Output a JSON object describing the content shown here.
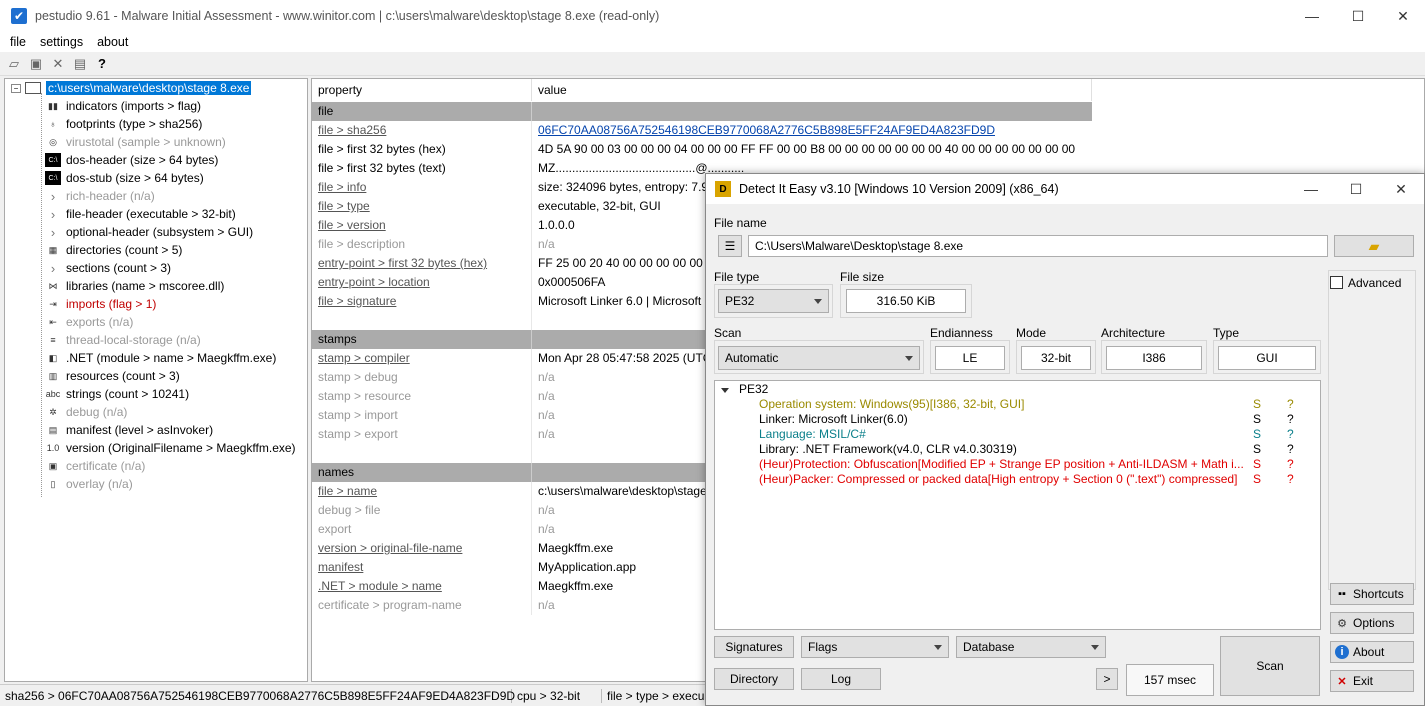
{
  "pestudio": {
    "title": "pestudio 9.61 - Malware Initial Assessment - www.winitor.com | c:\\users\\malware\\desktop\\stage 8.exe (read-only)",
    "menu": [
      "file",
      "settings",
      "about"
    ],
    "tree": {
      "root": "c:\\users\\malware\\desktop\\stage 8.exe",
      "items": [
        {
          "label": "indicators (imports > flag)",
          "icon": "bar-chart-icon",
          "state": "normal"
        },
        {
          "label": "footprints (type > sha256)",
          "icon": "footprints-icon",
          "state": "normal"
        },
        {
          "label": "virustotal (sample > unknown)",
          "icon": "virustotal-icon",
          "state": "dim"
        },
        {
          "label": "dos-header (size > 64 bytes)",
          "icon": "console-icon",
          "state": "normal"
        },
        {
          "label": "dos-stub (size > 64 bytes)",
          "icon": "console-icon",
          "state": "normal"
        },
        {
          "label": "rich-header (n/a)",
          "icon": "chevron-right-icon",
          "state": "dim"
        },
        {
          "label": "file-header (executable > 32-bit)",
          "icon": "chevron-right-icon",
          "state": "normal"
        },
        {
          "label": "optional-header (subsystem > GUI)",
          "icon": "chevron-right-icon",
          "state": "normal"
        },
        {
          "label": "directories (count > 5)",
          "icon": "grid-icon",
          "state": "normal"
        },
        {
          "label": "sections (count > 3)",
          "icon": "chevron-right-icon",
          "state": "normal"
        },
        {
          "label": "libraries (name > mscoree.dll)",
          "icon": "share-icon",
          "state": "normal"
        },
        {
          "label": "imports (flag > 1)",
          "icon": "imports-icon",
          "state": "red"
        },
        {
          "label": "exports (n/a)",
          "icon": "exports-icon",
          "state": "dim"
        },
        {
          "label": "thread-local-storage (n/a)",
          "icon": "thread-icon",
          "state": "dim"
        },
        {
          "label": ".NET (module > name > Maegkffm.exe)",
          "icon": "dotnet-icon",
          "state": "normal"
        },
        {
          "label": "resources (count > 3)",
          "icon": "resources-icon",
          "state": "normal"
        },
        {
          "label": "strings (count > 10241)",
          "icon": "abc-icon",
          "state": "normal"
        },
        {
          "label": "debug (n/a)",
          "icon": "bug-icon",
          "state": "dim"
        },
        {
          "label": "manifest (level > asInvoker)",
          "icon": "manifest-icon",
          "state": "normal"
        },
        {
          "label": "version (OriginalFilename > Maegkffm.exe)",
          "icon": "version-icon",
          "state": "normal"
        },
        {
          "label": "certificate (n/a)",
          "icon": "certificate-icon",
          "state": "dim"
        },
        {
          "label": "overlay (n/a)",
          "icon": "page-icon",
          "state": "dim"
        }
      ]
    },
    "table": {
      "headers": [
        "property",
        "value"
      ],
      "rows": [
        {
          "type": "group",
          "property": "file",
          "value": ""
        },
        {
          "type": "row",
          "property": "file > sha256",
          "value": "06FC70AA08756A752546198CEB9770068A2776C5B898E5FF24AF9ED4A823FD9D",
          "pstyle": "ul",
          "vstyle": "link"
        },
        {
          "type": "row",
          "property": "file > first 32 bytes (hex)",
          "value": "4D 5A 90 00 03 00 00 00 04 00 00 00 FF FF 00 00 B8 00 00 00 00 00 00 00 40 00 00 00 00 00 00 00",
          "pstyle": "",
          "vstyle": ""
        },
        {
          "type": "row",
          "property": "file > first 32 bytes (text)",
          "value": "MZ..........................................@...........",
          "pstyle": "",
          "vstyle": ""
        },
        {
          "type": "row",
          "property": "file > info",
          "value": "size: 324096 bytes, entropy: 7.97",
          "pstyle": "ul",
          "vstyle": ""
        },
        {
          "type": "row",
          "property": "file > type",
          "value": "executable, 32-bit, GUI",
          "pstyle": "ul",
          "vstyle": ""
        },
        {
          "type": "row",
          "property": "file > version",
          "value": "1.0.0.0",
          "pstyle": "ul",
          "vstyle": ""
        },
        {
          "type": "row",
          "property": "file > description",
          "value": "n/a",
          "pstyle": "dim",
          "vstyle": "dim"
        },
        {
          "type": "row",
          "property": "entry-point > first 32 bytes (hex)",
          "value": "FF 25 00 20 40 00 00 00 00 00 00 00",
          "pstyle": "ul",
          "vstyle": ""
        },
        {
          "type": "row",
          "property": "entry-point > location",
          "value": "0x000506FA",
          "pstyle": "ul",
          "vstyle": ""
        },
        {
          "type": "row",
          "property": "file > signature",
          "value": "Microsoft Linker 6.0 | Microsoft",
          "pstyle": "ul",
          "vstyle": ""
        },
        {
          "type": "blank",
          "property": "",
          "value": ""
        },
        {
          "type": "group",
          "property": "stamps",
          "value": ""
        },
        {
          "type": "row",
          "property": "stamp > compiler",
          "value": "Mon Apr 28 05:47:58 2025 (UTC)",
          "pstyle": "ul",
          "vstyle": ""
        },
        {
          "type": "row",
          "property": "stamp > debug",
          "value": "n/a",
          "pstyle": "dim",
          "vstyle": "dim"
        },
        {
          "type": "row",
          "property": "stamp > resource",
          "value": "n/a",
          "pstyle": "dim",
          "vstyle": "dim"
        },
        {
          "type": "row",
          "property": "stamp > import",
          "value": "n/a",
          "pstyle": "dim",
          "vstyle": "dim"
        },
        {
          "type": "row",
          "property": "stamp > export",
          "value": "n/a",
          "pstyle": "dim",
          "vstyle": "dim"
        },
        {
          "type": "blank",
          "property": "",
          "value": ""
        },
        {
          "type": "group",
          "property": "names",
          "value": ""
        },
        {
          "type": "row",
          "property": "file > name",
          "value": "c:\\users\\malware\\desktop\\stage",
          "pstyle": "ul",
          "vstyle": ""
        },
        {
          "type": "row",
          "property": "debug > file",
          "value": "n/a",
          "pstyle": "dim",
          "vstyle": "dim"
        },
        {
          "type": "row",
          "property": "export",
          "value": "n/a",
          "pstyle": "dim",
          "vstyle": "dim"
        },
        {
          "type": "row",
          "property": "version > original-file-name",
          "value": "Maegkffm.exe",
          "pstyle": "ul",
          "vstyle": ""
        },
        {
          "type": "row",
          "property": "manifest",
          "value": "MyApplication.app",
          "pstyle": "ul",
          "vstyle": ""
        },
        {
          "type": "row",
          "property": ".NET > module > name",
          "value": "Maegkffm.exe",
          "pstyle": "ul",
          "vstyle": ""
        },
        {
          "type": "row",
          "property": "certificate > program-name",
          "value": "n/a",
          "pstyle": "dim",
          "vstyle": "dim"
        }
      ]
    },
    "status": [
      "sha256 > 06FC70AA08756A752546198CEB9770068A2776C5B898E5FF24AF9ED4A823FD9D",
      "cpu > 32-bit",
      "file > type > execu"
    ]
  },
  "die": {
    "title": "Detect It Easy v3.10 [Windows 10 Version 2009] (x86_64)",
    "file_name_label": "File name",
    "file_name_value": "C:\\Users\\Malware\\Desktop\\stage 8.exe",
    "file_type_label": "File type",
    "file_type_value": "PE32",
    "file_size_label": "File size",
    "file_size_value": "316.50 KiB",
    "advanced_label": "Advanced",
    "scan_label": "Scan",
    "scan_value": "Automatic",
    "endianness_label": "Endianness",
    "endianness_value": "LE",
    "mode_label": "Mode",
    "mode_value": "32-bit",
    "arch_label": "Architecture",
    "arch_value": "I386",
    "type_label": "Type",
    "type_value": "GUI",
    "result_root": "PE32",
    "results": [
      {
        "text": "Operation system: Windows(95)[I386, 32-bit, GUI]",
        "s": "S",
        "q": "?",
        "color": "#9a8a00"
      },
      {
        "text": "Linker: Microsoft Linker(6.0)",
        "s": "S",
        "q": "?",
        "color": "#000000"
      },
      {
        "text": "Language: MSIL/C#",
        "s": "S",
        "q": "?",
        "color": "#0a7f8a"
      },
      {
        "text": "Library: .NET Framework(v4.0, CLR v4.0.30319)",
        "s": "S",
        "q": "?",
        "color": "#000000"
      },
      {
        "text": "(Heur)Protection: Obfuscation[Modified EP + Strange EP position + Anti-ILDASM + Math i...",
        "s": "S",
        "q": "?",
        "color": "#e00000"
      },
      {
        "text": "(Heur)Packer: Compressed or packed data[High entropy + Section 0 (\".text\") compressed]",
        "s": "S",
        "q": "?",
        "color": "#e00000"
      }
    ],
    "side_buttons": [
      {
        "label": "Shortcuts",
        "icon": "shortcuts-icon"
      },
      {
        "label": "Options",
        "icon": "gear-icon"
      },
      {
        "label": "About",
        "icon": "info-icon"
      },
      {
        "label": "Exit",
        "icon": "exit-icon"
      }
    ],
    "signatures_label": "Signatures",
    "flags_label": "Flags",
    "database_label": "Database",
    "directory_label": "Directory",
    "log_label": "Log",
    "more_label": ">",
    "time_label": "157 msec",
    "scan_button_label": "Scan"
  }
}
